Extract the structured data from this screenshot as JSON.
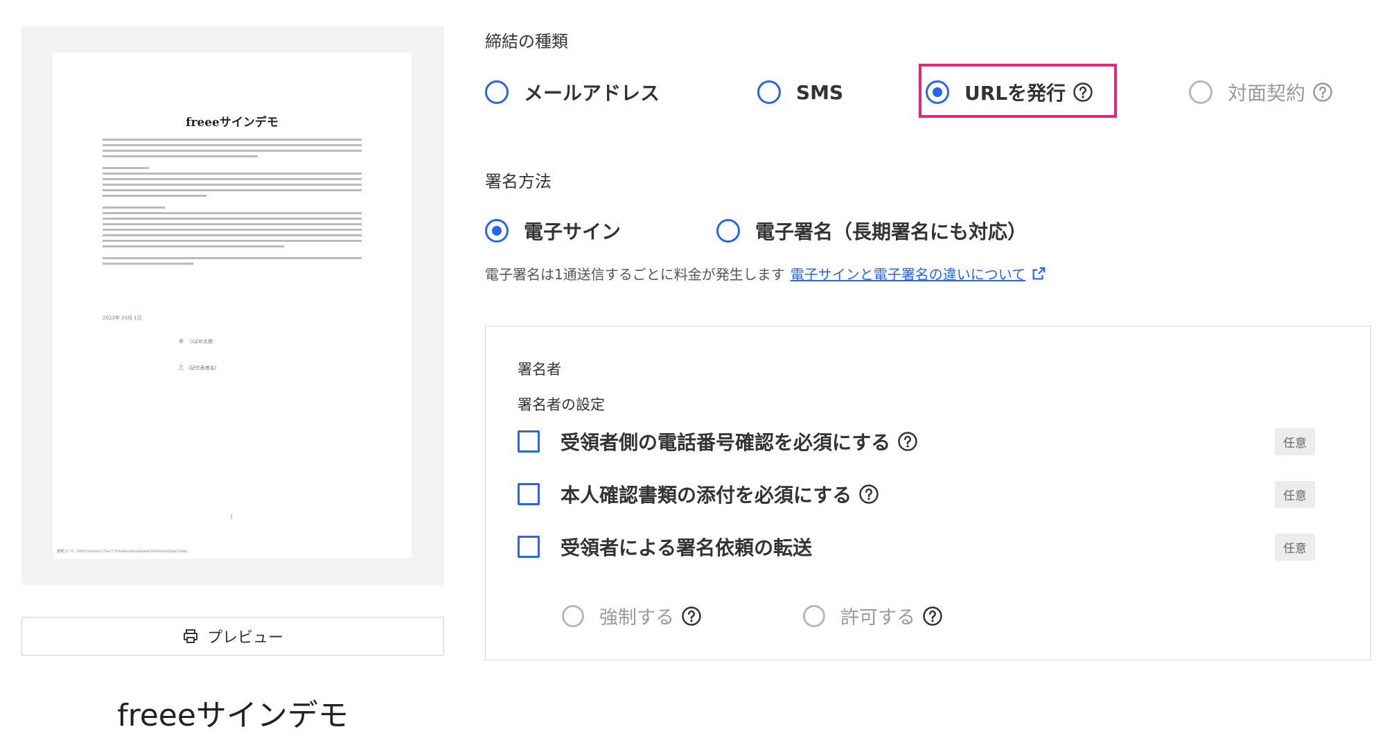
{
  "document": {
    "page_title": "freeeサインデモ",
    "date_line": "2023年 10月 1日",
    "party_a": "甲　つばめ太郎",
    "party_b": "乙　(記代表者名)",
    "page_number": "1",
    "footer_text": "書類コード: 1985150ed63175e17763d6ea0b0bd6a6463993bb03f3bb53346"
  },
  "preview_button": {
    "label": "プレビュー",
    "icon": "printer-icon"
  },
  "document_name": "freeeサインデモ",
  "contract_type": {
    "title": "締結の種類",
    "options": [
      {
        "label": "メールアドレス",
        "checked": false,
        "disabled": false
      },
      {
        "label": "SMS",
        "checked": false,
        "disabled": false
      },
      {
        "label": "URLを発行",
        "checked": true,
        "disabled": false,
        "help": true
      },
      {
        "label": "対面契約",
        "checked": false,
        "disabled": true,
        "help": true
      }
    ]
  },
  "signing_method": {
    "title": "署名方法",
    "options": [
      {
        "label": "電子サイン",
        "checked": true
      },
      {
        "label": "電子署名（長期署名にも対応）",
        "checked": false
      }
    ],
    "note": "電子署名は1通送信するごとに料金が発生します",
    "link": "電子サインと電子署名の違いについて"
  },
  "signer": {
    "title": "署名者",
    "settings_title": "署名者の設定",
    "options": [
      {
        "label": "受領者側の電話番号確認を必須にする",
        "badge": "任意",
        "help": true
      },
      {
        "label": "本人確認書類の添付を必須にする",
        "badge": "任意",
        "help": true
      },
      {
        "label": "受領者による署名依頼の転送",
        "badge": "任意",
        "help": false
      }
    ],
    "forward_options": [
      {
        "label": "強制する"
      },
      {
        "label": "許可する"
      }
    ]
  },
  "colors": {
    "accent": "#2864f0",
    "highlight": "#e8247a",
    "disabled": "#9a9a9a"
  }
}
